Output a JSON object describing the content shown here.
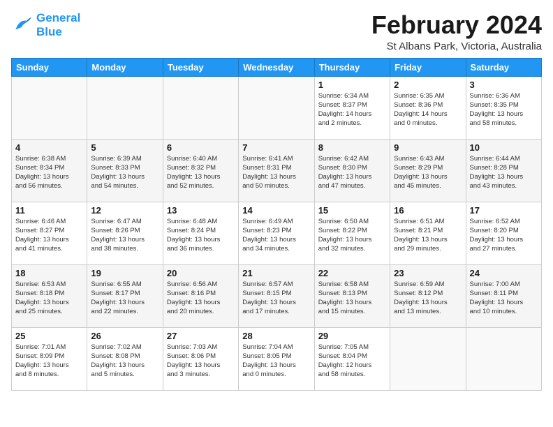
{
  "header": {
    "logo_line1": "General",
    "logo_line2": "Blue",
    "month": "February 2024",
    "location": "St Albans Park, Victoria, Australia"
  },
  "weekdays": [
    "Sunday",
    "Monday",
    "Tuesday",
    "Wednesday",
    "Thursday",
    "Friday",
    "Saturday"
  ],
  "weeks": [
    [
      {
        "day": "",
        "info": ""
      },
      {
        "day": "",
        "info": ""
      },
      {
        "day": "",
        "info": ""
      },
      {
        "day": "",
        "info": ""
      },
      {
        "day": "1",
        "info": "Sunrise: 6:34 AM\nSunset: 8:37 PM\nDaylight: 14 hours\nand 2 minutes."
      },
      {
        "day": "2",
        "info": "Sunrise: 6:35 AM\nSunset: 8:36 PM\nDaylight: 14 hours\nand 0 minutes."
      },
      {
        "day": "3",
        "info": "Sunrise: 6:36 AM\nSunset: 8:35 PM\nDaylight: 13 hours\nand 58 minutes."
      }
    ],
    [
      {
        "day": "4",
        "info": "Sunrise: 6:38 AM\nSunset: 8:34 PM\nDaylight: 13 hours\nand 56 minutes."
      },
      {
        "day": "5",
        "info": "Sunrise: 6:39 AM\nSunset: 8:33 PM\nDaylight: 13 hours\nand 54 minutes."
      },
      {
        "day": "6",
        "info": "Sunrise: 6:40 AM\nSunset: 8:32 PM\nDaylight: 13 hours\nand 52 minutes."
      },
      {
        "day": "7",
        "info": "Sunrise: 6:41 AM\nSunset: 8:31 PM\nDaylight: 13 hours\nand 50 minutes."
      },
      {
        "day": "8",
        "info": "Sunrise: 6:42 AM\nSunset: 8:30 PM\nDaylight: 13 hours\nand 47 minutes."
      },
      {
        "day": "9",
        "info": "Sunrise: 6:43 AM\nSunset: 8:29 PM\nDaylight: 13 hours\nand 45 minutes."
      },
      {
        "day": "10",
        "info": "Sunrise: 6:44 AM\nSunset: 8:28 PM\nDaylight: 13 hours\nand 43 minutes."
      }
    ],
    [
      {
        "day": "11",
        "info": "Sunrise: 6:46 AM\nSunset: 8:27 PM\nDaylight: 13 hours\nand 41 minutes."
      },
      {
        "day": "12",
        "info": "Sunrise: 6:47 AM\nSunset: 8:26 PM\nDaylight: 13 hours\nand 38 minutes."
      },
      {
        "day": "13",
        "info": "Sunrise: 6:48 AM\nSunset: 8:24 PM\nDaylight: 13 hours\nand 36 minutes."
      },
      {
        "day": "14",
        "info": "Sunrise: 6:49 AM\nSunset: 8:23 PM\nDaylight: 13 hours\nand 34 minutes."
      },
      {
        "day": "15",
        "info": "Sunrise: 6:50 AM\nSunset: 8:22 PM\nDaylight: 13 hours\nand 32 minutes."
      },
      {
        "day": "16",
        "info": "Sunrise: 6:51 AM\nSunset: 8:21 PM\nDaylight: 13 hours\nand 29 minutes."
      },
      {
        "day": "17",
        "info": "Sunrise: 6:52 AM\nSunset: 8:20 PM\nDaylight: 13 hours\nand 27 minutes."
      }
    ],
    [
      {
        "day": "18",
        "info": "Sunrise: 6:53 AM\nSunset: 8:18 PM\nDaylight: 13 hours\nand 25 minutes."
      },
      {
        "day": "19",
        "info": "Sunrise: 6:55 AM\nSunset: 8:17 PM\nDaylight: 13 hours\nand 22 minutes."
      },
      {
        "day": "20",
        "info": "Sunrise: 6:56 AM\nSunset: 8:16 PM\nDaylight: 13 hours\nand 20 minutes."
      },
      {
        "day": "21",
        "info": "Sunrise: 6:57 AM\nSunset: 8:15 PM\nDaylight: 13 hours\nand 17 minutes."
      },
      {
        "day": "22",
        "info": "Sunrise: 6:58 AM\nSunset: 8:13 PM\nDaylight: 13 hours\nand 15 minutes."
      },
      {
        "day": "23",
        "info": "Sunrise: 6:59 AM\nSunset: 8:12 PM\nDaylight: 13 hours\nand 13 minutes."
      },
      {
        "day": "24",
        "info": "Sunrise: 7:00 AM\nSunset: 8:11 PM\nDaylight: 13 hours\nand 10 minutes."
      }
    ],
    [
      {
        "day": "25",
        "info": "Sunrise: 7:01 AM\nSunset: 8:09 PM\nDaylight: 13 hours\nand 8 minutes."
      },
      {
        "day": "26",
        "info": "Sunrise: 7:02 AM\nSunset: 8:08 PM\nDaylight: 13 hours\nand 5 minutes."
      },
      {
        "day": "27",
        "info": "Sunrise: 7:03 AM\nSunset: 8:06 PM\nDaylight: 13 hours\nand 3 minutes."
      },
      {
        "day": "28",
        "info": "Sunrise: 7:04 AM\nSunset: 8:05 PM\nDaylight: 13 hours\nand 0 minutes."
      },
      {
        "day": "29",
        "info": "Sunrise: 7:05 AM\nSunset: 8:04 PM\nDaylight: 12 hours\nand 58 minutes."
      },
      {
        "day": "",
        "info": ""
      },
      {
        "day": "",
        "info": ""
      }
    ]
  ]
}
